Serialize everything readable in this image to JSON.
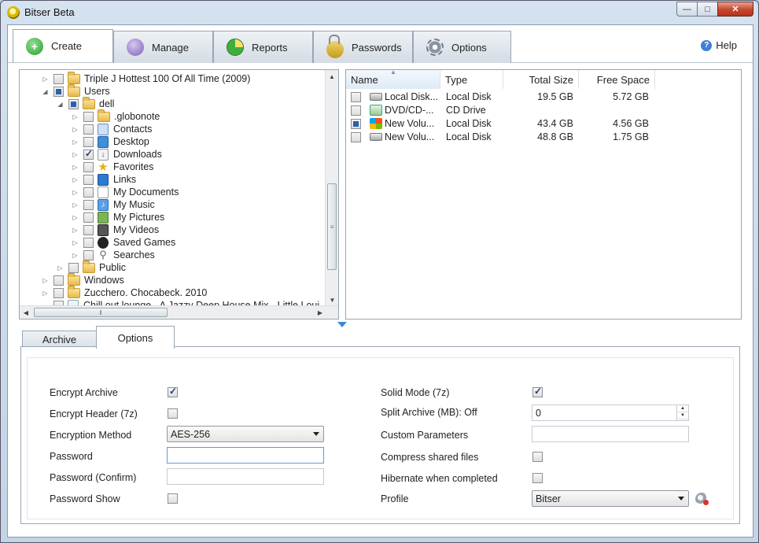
{
  "window": {
    "title": "Bitser Beta"
  },
  "toolbar": {
    "tabs": [
      {
        "label": "Create"
      },
      {
        "label": "Manage"
      },
      {
        "label": "Reports"
      },
      {
        "label": "Passwords"
      },
      {
        "label": "Options"
      }
    ],
    "help_label": "Help"
  },
  "tree": {
    "rows": [
      {
        "label": "Triple J Hottest 100 Of All Time (2009)"
      },
      {
        "label": "Users"
      },
      {
        "label": "dell"
      },
      {
        "label": ".globonote"
      },
      {
        "label": "Contacts"
      },
      {
        "label": "Desktop"
      },
      {
        "label": "Downloads"
      },
      {
        "label": "Favorites"
      },
      {
        "label": "Links"
      },
      {
        "label": "My Documents"
      },
      {
        "label": "My Music"
      },
      {
        "label": "My Pictures"
      },
      {
        "label": "My Videos"
      },
      {
        "label": "Saved Games"
      },
      {
        "label": "Searches"
      },
      {
        "label": "Public"
      },
      {
        "label": "Windows"
      },
      {
        "label": "Zucchero. Chocabeck. 2010"
      },
      {
        "label": "Chill out lounge - A Jazzy Deep House Mix - Little Loui"
      }
    ]
  },
  "drives": {
    "headers": {
      "name": "Name",
      "type": "Type",
      "total": "Total Size",
      "free": "Free Space"
    },
    "rows": [
      {
        "name": "Local Disk...",
        "type": "Local Disk",
        "total": "19.5 GB",
        "free": "5.72 GB"
      },
      {
        "name": "DVD/CD-...",
        "type": "CD Drive",
        "total": "",
        "free": ""
      },
      {
        "name": "New Volu...",
        "type": "Local Disk",
        "total": "43.4 GB",
        "free": "4.56 GB"
      },
      {
        "name": "New Volu...",
        "type": "Local Disk",
        "total": "48.8 GB",
        "free": "1.75 GB"
      }
    ]
  },
  "bottom_tabs": {
    "archive": "Archive",
    "options": "Options"
  },
  "options": {
    "encrypt_archive": "Encrypt Archive",
    "encrypt_header": "Encrypt Header (7z)",
    "encryption_method": "Encryption Method",
    "encryption_method_value": "AES-256",
    "password": "Password",
    "password_confirm": "Password (Confirm)",
    "password_show": "Password Show",
    "solid_mode": "Solid Mode (7z)",
    "split_archive": "Split Archive (MB): Off",
    "split_value": "0",
    "custom_parameters": "Custom Parameters",
    "compress_shared": "Compress shared files",
    "hibernate": "Hibernate when completed",
    "profile": "Profile",
    "profile_value": "Bitser"
  },
  "colors": {
    "accent": "#3f86d6",
    "frame": "#c3d4e6"
  }
}
